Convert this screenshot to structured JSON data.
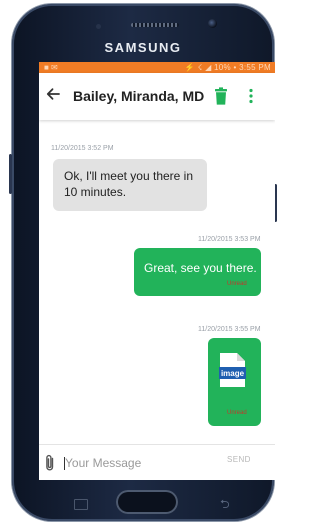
{
  "device": {
    "brand": "SAMSUNG"
  },
  "status_bar": {
    "left_text": "■ ✉",
    "right_text": "⚡ ☇ ◢ 10% • 3:55 PM"
  },
  "header": {
    "title": "Bailey, Miranda, MD",
    "back_icon": "arrow-left-icon",
    "delete_icon": "trash-icon",
    "menu_icon": "more-vertical-icon",
    "accent_color": "#22b35a"
  },
  "messages": [
    {
      "direction": "incoming",
      "timestamp": "11/20/2015 3:52 PM",
      "text": "Ok, I'll meet you there in 10 minutes."
    },
    {
      "direction": "outgoing",
      "timestamp": "11/20/2015 3:53 PM",
      "text": "Great, see you there.",
      "status": "Unread"
    },
    {
      "direction": "outgoing",
      "timestamp": "11/20/2015 3:55 PM",
      "attachment_label": "image",
      "attachment_icon": "image-file-icon",
      "status": "Unread"
    }
  ],
  "composer": {
    "placeholder": "Your Message",
    "send_label": "SEND",
    "attach_icon": "paperclip-icon"
  },
  "colors": {
    "status_bar": "#f07c25",
    "outgoing_bubble": "#22b35a",
    "incoming_bubble": "#e2e2e2",
    "unread_text": "#c0392b"
  }
}
